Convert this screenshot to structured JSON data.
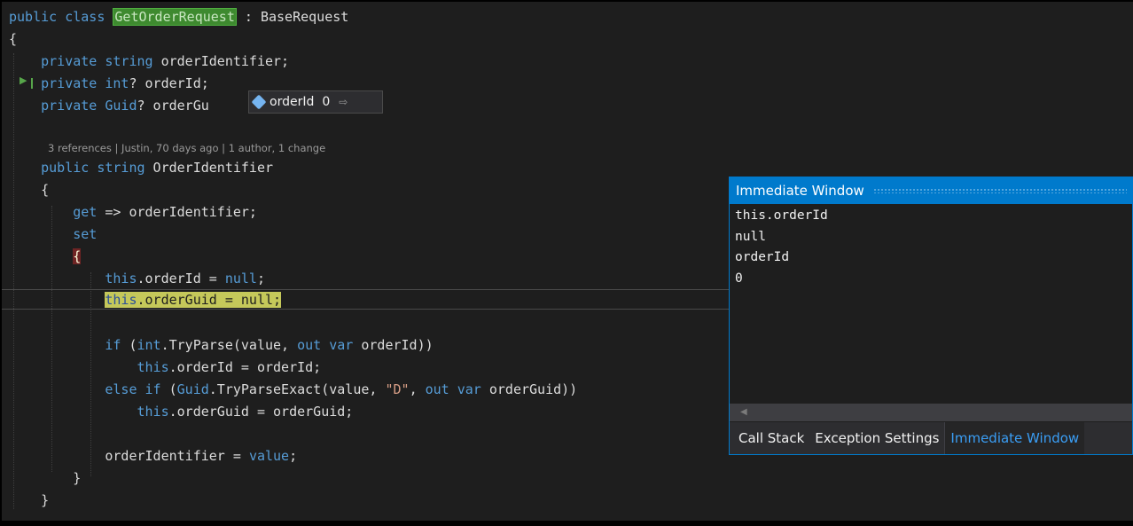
{
  "code_lines": [
    {
      "text": "public class GetOrderRequest : BaseRequest"
    },
    {
      "text": "{"
    },
    {
      "text": "    private string orderIdentifier;"
    },
    {
      "text": "    private int? orderId;"
    },
    {
      "text": "    private Guid? orderGu"
    },
    {
      "text": ""
    },
    {
      "text": "    public string OrderIdentifier"
    },
    {
      "text": "    {"
    },
    {
      "text": "        get => orderIdentifier;"
    },
    {
      "text": "        set"
    },
    {
      "text": "        {"
    },
    {
      "text": "            this.orderId = null;"
    },
    {
      "text": "            this.orderGuid = null;"
    },
    {
      "text": ""
    },
    {
      "text": "            if (int.TryParse(value, out var orderId))"
    },
    {
      "text": "                this.orderId = orderId;"
    },
    {
      "text": "            else if (Guid.TryParseExact(value, \"D\", out var orderGuid))"
    },
    {
      "text": "                this.orderGuid = orderGuid;"
    },
    {
      "text": ""
    },
    {
      "text": "            orderIdentifier = value;"
    },
    {
      "text": "        }"
    },
    {
      "text": "    }"
    }
  ],
  "codelens": {
    "text": "3 references | Justin, 70 days ago | 1 author, 1 change"
  },
  "datatip": {
    "name": "orderId",
    "value": "0",
    "icon": "field-icon"
  },
  "immediate_window": {
    "title": "Immediate Window",
    "lines": [
      "this.orderId",
      "null",
      "orderId",
      "0"
    ],
    "tabs": [
      "Call Stack",
      "Exception Settings",
      "Immediate Window"
    ],
    "active_tab": "Immediate Window"
  },
  "colors": {
    "editor_bg": "#1e1e1e",
    "keyword": "#569cd6",
    "accent": "#007acc",
    "execution_highlight": "#c5c85a",
    "reference_highlight": "#3e8a2f",
    "breakpoint_brace": "#6f2424"
  }
}
